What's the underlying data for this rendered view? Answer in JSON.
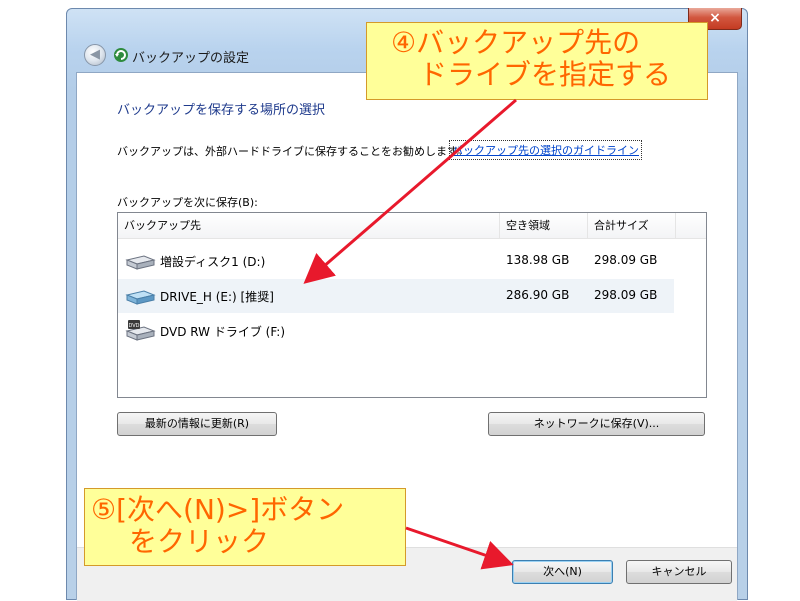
{
  "window": {
    "title": "バックアップの設定",
    "close_glyph": "×",
    "back_glyph": "◀"
  },
  "content": {
    "heading": "バックアップを保存する場所の選択",
    "description": "バックアップは、外部ハードドライブに保存することをお勧めします。",
    "guideline_link": "バックアップ先の選択のガイドライン",
    "save_in_label": "バックアップを次に保存(B):"
  },
  "list": {
    "columns": [
      "バックアップ先",
      "空き領域",
      "合計サイズ"
    ],
    "rows": [
      {
        "name": "増設ディスク1 (D:)",
        "free": "138.98 GB",
        "total": "298.09 GB",
        "icon": "hard-drive-icon",
        "selected": false
      },
      {
        "name": "DRIVE_H (E:) [推奨]",
        "free": "286.90 GB",
        "total": "298.09 GB",
        "icon": "external-drive-icon",
        "selected": true
      },
      {
        "name": "DVD RW ドライブ (F:)",
        "free": "",
        "total": "",
        "icon": "dvd-drive-icon",
        "selected": false
      }
    ]
  },
  "buttons": {
    "refresh": "最新の情報に更新(R)",
    "network": "ネットワークに保存(V)...",
    "next": "次へ(N)",
    "cancel": "キャンセル"
  },
  "annotations": {
    "callout1_line1": "④バックアップ先の",
    "callout1_line2": "ドライブを指定する",
    "callout2_line1": "⑤[次へ(N)>]ボタン",
    "callout2_line2": "をクリック"
  },
  "colors": {
    "callout_bg": "#ffff99",
    "callout_text": "#ff6600",
    "arrow": "#e8192c",
    "heading": "#1e3a8c"
  }
}
